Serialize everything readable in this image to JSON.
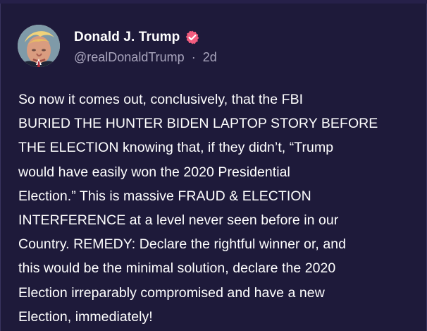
{
  "post": {
    "author": {
      "display_name": "Donald J. Trump",
      "verified": true,
      "handle": "@realDonaldTrump",
      "separator": "·",
      "time_ago": "2d",
      "avatar_icon": "profile-photo-avatar"
    },
    "body_lines": [
      "So now it comes out, conclusively, that the FBI",
      "BURIED THE HUNTER BIDEN LAPTOP STORY BEFORE",
      "THE ELECTION knowing that, if they didn’t, “Trump",
      "would have easily won the 2020 Presidential",
      "Election.” This is massive FRAUD & ELECTION",
      "INTERFERENCE at a  level never seen before in our",
      "Country. REMEDY: Declare the rightful winner or, and",
      "this would be the minimal solution, declare the 2020",
      "Election irreparably compromised and have a new",
      "Election, immediately!"
    ]
  },
  "colors": {
    "background": "#1e1a3a",
    "text": "#ffffff",
    "muted_text": "#a9a5bd",
    "verified_badge": "#f25c7e"
  },
  "icons": {
    "verified": "verified-badge-icon"
  }
}
